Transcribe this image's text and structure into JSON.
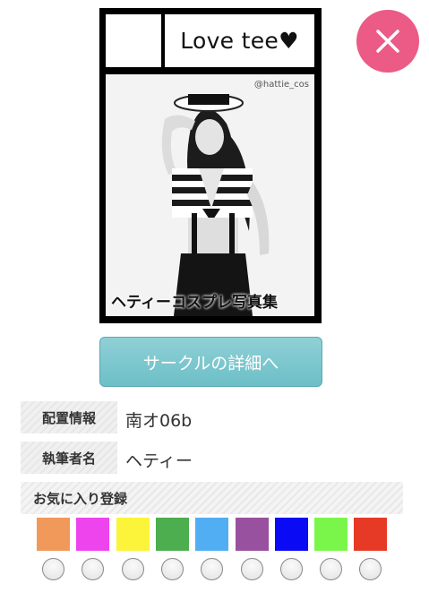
{
  "close_button": {
    "icon": "close-icon",
    "color": "#ec5a86"
  },
  "circle_cut": {
    "name": "Love tee♥",
    "handle": "@hattie_cos",
    "caption": "ヘティーコスプレ写真集"
  },
  "detail_button": {
    "label": "サークルの詳細へ"
  },
  "info": {
    "placement_label": "配置情報",
    "placement_value": "南オ06b",
    "author_label": "執筆者名",
    "author_value": "ヘティー"
  },
  "favorites": {
    "label": "お気に入り登録",
    "colors": [
      "#f0995a",
      "#ee44ee",
      "#fcf43a",
      "#4cae4f",
      "#52aef2",
      "#97519e",
      "#0a0af4",
      "#7af64a",
      "#e63a27"
    ]
  }
}
